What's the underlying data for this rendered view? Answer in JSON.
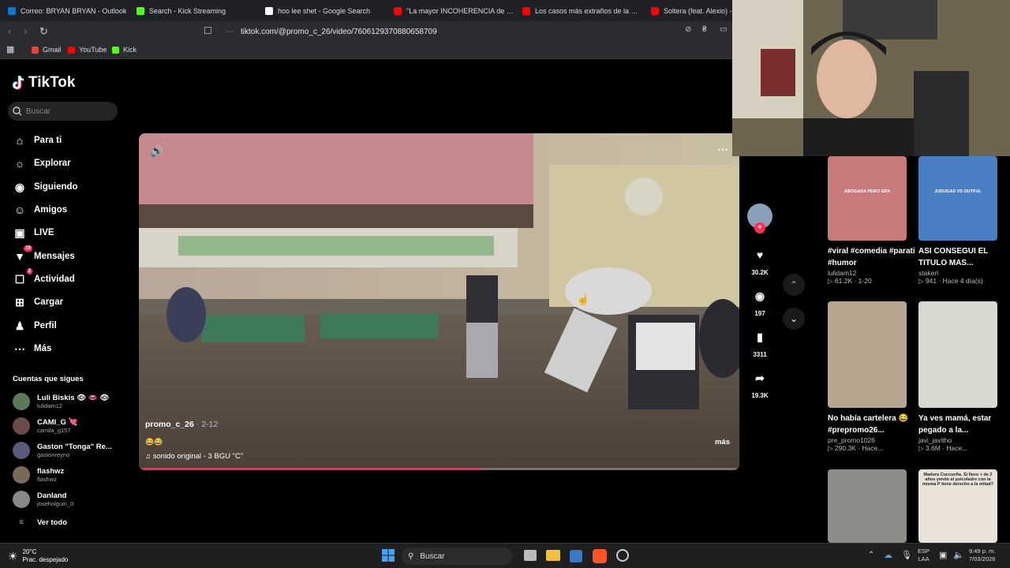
{
  "browser": {
    "tabs": [
      {
        "title": "Correo: BRYAN BRYAN - Outlook",
        "icon": "outlook-icon",
        "color": "#0078d4"
      },
      {
        "title": "Search - Kick Streaming",
        "icon": "kick-icon",
        "color": "#53fc18"
      },
      {
        "title": "hoo lee shet - Google Search",
        "icon": "google-icon",
        "color": "#ffffff"
      },
      {
        "title": "\"La mayor INCOHERENCIA de GOD",
        "icon": "youtube-icon",
        "color": "#ff0000"
      },
      {
        "title": "Los casos más extraños de la CIA - Y",
        "icon": "youtube-icon",
        "color": "#ff0000"
      },
      {
        "title": "Soltera (feat. Alexio) - You",
        "icon": "youtube-icon",
        "color": "#ff0000"
      }
    ],
    "url": "tiktok.com/@promo_c_26/video/7606129370880658709",
    "bookmarks": [
      {
        "label": "Gmail",
        "color": "#ea4335"
      },
      {
        "label": "YouTube",
        "color": "#ff0000"
      },
      {
        "label": "Kick",
        "color": "#53fc18"
      }
    ]
  },
  "sidebar": {
    "brand": "TikTok",
    "search_placeholder": "Buscar",
    "nav": [
      {
        "label": "Para ti",
        "icon": "home-icon"
      },
      {
        "label": "Explorar",
        "icon": "compass-icon"
      },
      {
        "label": "Siguiendo",
        "icon": "following-avatar-icon"
      },
      {
        "label": "Amigos",
        "icon": "friends-icon"
      },
      {
        "label": "LIVE",
        "icon": "live-icon"
      },
      {
        "label": "Mensajes",
        "icon": "messages-icon",
        "badge": "15"
      },
      {
        "label": "Actividad",
        "icon": "activity-icon",
        "badge": "2"
      },
      {
        "label": "Cargar",
        "icon": "upload-icon"
      },
      {
        "label": "Perfil",
        "icon": "profile-icon"
      },
      {
        "label": "Más",
        "icon": "more-icon"
      }
    ],
    "following_title": "Cuentas que sigues",
    "following": [
      {
        "name": "Luli Biskis 👁 👄 👁",
        "handle": "lulidam12"
      },
      {
        "name": "CAMI_G 💘",
        "handle": "camila_g157"
      },
      {
        "name": "Gaston \"Tonga\" Re...",
        "handle": "gastonreyno"
      },
      {
        "name": "flashwz",
        "handle": "flashwz"
      },
      {
        "name": "Danland",
        "handle": "joseholguin_0"
      }
    ],
    "see_all": "Ver todo"
  },
  "video": {
    "author": "promo_c_26",
    "date": " · 2-12",
    "caption": "😂😂",
    "sound": "sonido original - 3 BGU \"C\"",
    "more": "más",
    "progress": 0.57
  },
  "actions": {
    "likes": "30.2K",
    "comments": "197",
    "saves": "3311",
    "shares": "19.3K"
  },
  "recommendations": [
    {
      "caption": "#viral #comedia #parati #humor",
      "user": "lulidam12",
      "stats": "▷ 61.2K · 1-20",
      "thumb_text": "ABOGADA PERO ERA",
      "color": "#c87a7a"
    },
    {
      "caption": "ASI CONSEGUI EL TITULO MAS...",
      "user": "stakerl",
      "stats": "▷ 941 · Hace 4 día(s)",
      "thumb_text": "JUDUGAS VS OUTFUL",
      "color": "#4b7fc4"
    },
    {
      "caption": "No había cartelera 😂#prepromo26...",
      "user": "pre_promo1026",
      "stats": "▷ 290.3K · Hace...",
      "thumb_text": "",
      "color": "#b6a690"
    },
    {
      "caption": "Ya ves mamá, estar pegado a la...",
      "user": "javi_javitho",
      "stats": "▷ 3.6M · Hace...",
      "thumb_text": "",
      "color": "#d8d8d0"
    },
    {
      "caption": "",
      "user": "",
      "stats": "",
      "thumb_text": "",
      "color": "#8c8c88"
    },
    {
      "caption": "",
      "user": "",
      "stats": "",
      "thumb_text": "Madura Cuccuefia. Si llevo + de 2 años yendo al psicoladre con la misma P tiene derecho a la mitad?",
      "color": "#e8e2d8"
    }
  ],
  "taskbar": {
    "temp": "20°C",
    "weather": "Prac. despejado",
    "search": "Buscar",
    "lang1": "ESP",
    "lang2": "LAA",
    "time": "9:49 p. m.",
    "date": "7/03/2026"
  }
}
